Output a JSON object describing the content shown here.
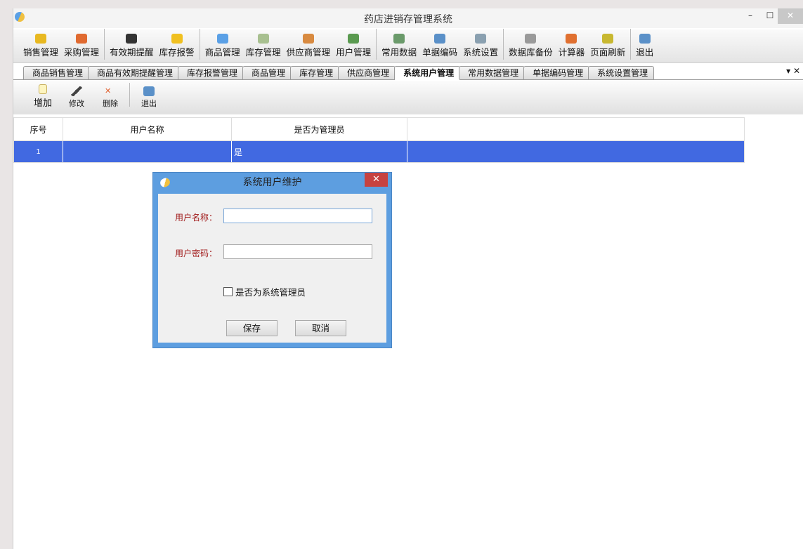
{
  "window": {
    "title": "药店进销存管理系统",
    "minimize": "–",
    "maximize": "☐",
    "close": "✕"
  },
  "toolbar": [
    {
      "label": "销售管理",
      "icon": "basket-icon",
      "color": "#e8b820"
    },
    {
      "label": "采购管理",
      "icon": "basket-icon",
      "color": "#e06a30"
    },
    {
      "sep": true
    },
    {
      "label": "有效期提醒",
      "icon": "clock-icon",
      "color": "#333333"
    },
    {
      "label": "库存报警",
      "icon": "warning-icon",
      "color": "#f0c020"
    },
    {
      "sep": true
    },
    {
      "label": "商品管理",
      "icon": "capsule-icon",
      "color": "#5aa0e6"
    },
    {
      "label": "库存管理",
      "icon": "inventory-icon",
      "color": "#a8c090"
    },
    {
      "label": "供应商管理",
      "icon": "supplier-icon",
      "color": "#d88a40"
    },
    {
      "label": "用户管理",
      "icon": "user-icon",
      "color": "#5a9a50"
    },
    {
      "sep": true
    },
    {
      "label": "常用数据",
      "icon": "calendar-icon",
      "color": "#6a9a6a"
    },
    {
      "label": "单据编码",
      "icon": "document-code-icon",
      "color": "#5a90c8"
    },
    {
      "label": "系统设置",
      "icon": "tools-icon",
      "color": "#8aa0b0"
    },
    {
      "sep": true
    },
    {
      "label": "数据库备份",
      "icon": "database-icon",
      "color": "#9a9a9a"
    },
    {
      "label": "计算器",
      "icon": "calculator-icon",
      "color": "#e07030"
    },
    {
      "label": "页面刷新",
      "icon": "refresh-icon",
      "color": "#c8b830"
    },
    {
      "sep": true
    },
    {
      "label": "退出",
      "icon": "exit-icon",
      "color": "#5a90c8"
    }
  ],
  "tabs": [
    {
      "label": "商品销售管理"
    },
    {
      "label": "商品有效期提醒管理"
    },
    {
      "label": "库存报警管理"
    },
    {
      "label": "商品管理"
    },
    {
      "label": "库存管理"
    },
    {
      "label": "供应商管理"
    },
    {
      "label": "系统用户管理",
      "active": true
    },
    {
      "label": "常用数据管理"
    },
    {
      "label": "单据编码管理"
    },
    {
      "label": "系统设置管理"
    }
  ],
  "tab_controls": {
    "dropdown": "▾",
    "close": "✕"
  },
  "subtoolbar": {
    "add": "增加",
    "edit": "修改",
    "delete": "删除",
    "exit": "退出"
  },
  "grid": {
    "columns": [
      "序号",
      "用户名称",
      "是否为管理员"
    ],
    "rows": [
      {
        "index": "1",
        "name": "",
        "is_admin": "是"
      }
    ]
  },
  "dialog": {
    "title": "系统用户维护",
    "close": "✕",
    "username_label": "用户名称：",
    "username_value": "",
    "password_label": "用户密码：",
    "password_value": "",
    "admin_checkbox_label": "是否为系统管理员",
    "admin_checked": false,
    "save": "保存",
    "cancel": "取消"
  }
}
